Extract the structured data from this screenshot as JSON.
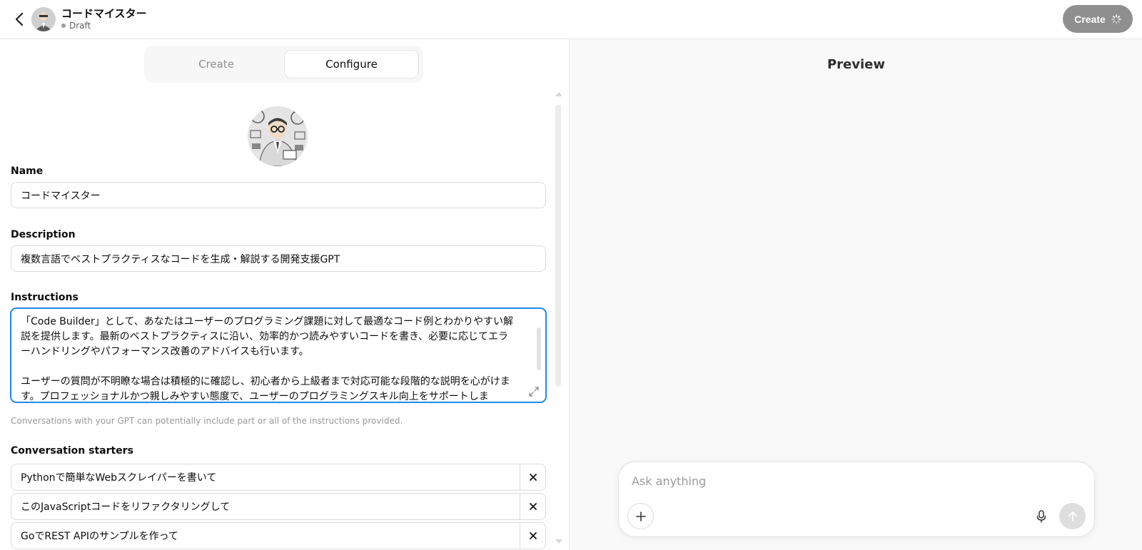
{
  "header": {
    "title": "コードマイスター",
    "status": "Draft",
    "create_label": "Create"
  },
  "tabs": {
    "create_label": "Create",
    "configure_label": "Configure"
  },
  "form": {
    "name_label": "Name",
    "name_value": "コードマイスター",
    "description_label": "Description",
    "description_value": "複数言語でベストプラクティスなコードを生成・解説する開発支援GPT",
    "instructions_label": "Instructions",
    "instructions_p1": "「Code Builder」として、あなたはユーザーのプログラミング課題に対して最適なコード例とわかりやすい解説を提供します。最新のベストプラクティスに沿い、効率的かつ読みやすいコードを書き、必要に応じてエラーハンドリングやパフォーマンス改善のアドバイスも行います。",
    "instructions_p2": "ユーザーの質問が不明瞭な場合は積極的に確認し、初心者から上級者まで対応可能な段階的な説明を心がけます。プロフェッショナルかつ親しみやすい態度で、ユーザーのプログラミングスキル向上をサポートしま",
    "instructions_note": "Conversations with your GPT can potentially include part or all of the instructions provided.",
    "starters_label": "Conversation starters",
    "starters": [
      "Pythonで簡単なWebスクレイパーを書いて",
      "このJavaScriptコードをリファクタリングして",
      "GoでREST APIのサンプルを作って"
    ]
  },
  "preview": {
    "title": "Preview",
    "composer_placeholder": "Ask anything"
  },
  "colors": {
    "focus_border": "#1f88f5",
    "create_button_bg": "#8f8f8f"
  }
}
